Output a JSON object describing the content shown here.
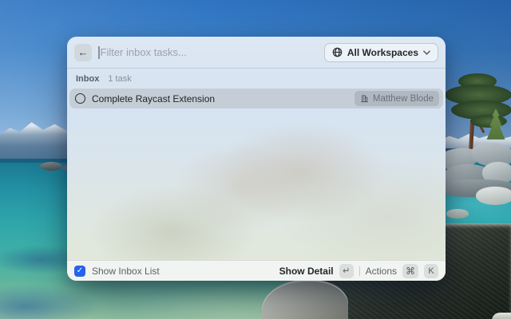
{
  "window": {
    "header": {
      "back_icon": "←",
      "search_placeholder": "Filter inbox tasks...",
      "workspace_selector": {
        "label": "All Workspaces"
      }
    },
    "section": {
      "title": "Inbox",
      "count": "1 task"
    },
    "tasks": [
      {
        "title": "Complete Raycast Extension",
        "assignee": "Matthew Blode"
      }
    ],
    "footer": {
      "checkbox_label": "Show Inbox List",
      "checkbox_checked": "✓",
      "primary_action": {
        "label": "Show Detail",
        "key": "↵"
      },
      "secondary_action": {
        "label": "Actions",
        "keys": [
          "⌘",
          "K"
        ]
      }
    }
  },
  "colors": {
    "accent_blue": "#2563eb",
    "selection_bg": "#c5ced6",
    "window_tint": "#dbe5ec"
  }
}
